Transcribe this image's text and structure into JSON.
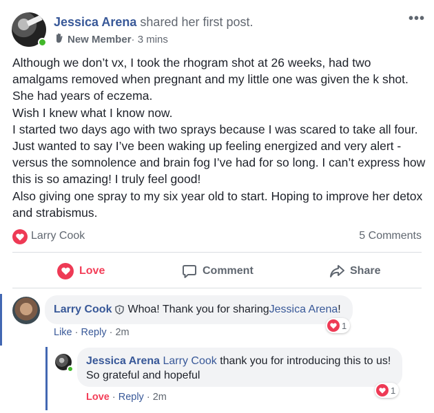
{
  "post": {
    "author_name": "Jessica Arena",
    "action_text": " shared her first post.",
    "badge": "New Member",
    "time": " · 3 mins",
    "menu_icon": "more-dots-icon",
    "more_label": "•••",
    "paragraphs": [
      "Although we don’t vx, I took the rhogram shot at 26 weeks, had two amalgams removed when pregnant and my little one was given the k shot. She had years of eczema.",
      "Wish I knew what I know now.",
      "I started two days ago with two sprays because I was scared to take all four. Just wanted to say I’ve been waking up feeling energized and very alert -versus the somnolence and brain fog I’ve had for so long. I can’t express how this is so amazing! I truly feel good!",
      "Also giving one spray to my six year old to start. Hoping to improve her detox and strabismus."
    ]
  },
  "reactions": {
    "reactor_name": "Larry Cook",
    "comments_count": "5 Comments"
  },
  "actions": {
    "love": "Love",
    "comment": "Comment",
    "share": "Share"
  },
  "comments": [
    {
      "author": "Larry Cook",
      "text": " Whoa! Thank you for sharing ",
      "mention": "Jessica Arena",
      "after": "!",
      "like": "Like",
      "reply": "Reply",
      "time": "2m",
      "reaction_count": "1"
    },
    {
      "author": "Jessica Arena",
      "mention": "Larry Cook",
      "text": " thank you for introducing this to us! So grateful and hopeful",
      "like": "Love",
      "reply": "Reply",
      "time": "2m",
      "reaction_count": "1"
    }
  ],
  "colors": {
    "link": "#385898",
    "love": "#f33e58",
    "online": "#42b72a",
    "thread_bar": "#4267b2",
    "bubble": "#f2f3f5"
  }
}
